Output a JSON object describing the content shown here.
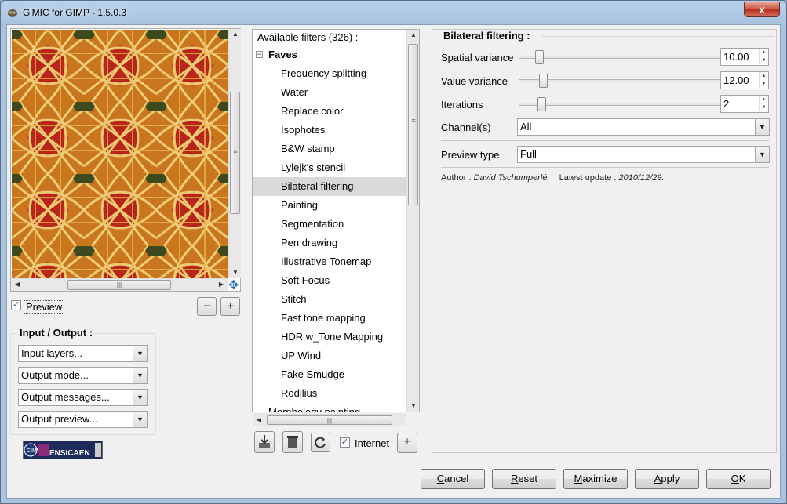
{
  "window": {
    "title": "G'MIC for GIMP - 1.5.0.3",
    "close_label": "x"
  },
  "preview": {
    "checkbox_checked": true,
    "label": "Preview",
    "zoom_out": "−",
    "zoom_in": "+"
  },
  "io": {
    "title": "Input / Output :",
    "combos": [
      "Input layers...",
      "Output mode...",
      "Output messages...",
      "Output preview..."
    ]
  },
  "logo": {
    "text": "ENSICAEN"
  },
  "filters": {
    "header": "Available filters (326) :",
    "category": "Faves",
    "items": [
      "Frequency splitting",
      "Water",
      "Replace color",
      "Isophotes",
      "B&W stamp",
      "Lylejk's stencil",
      "Bilateral filtering",
      "Painting",
      "Segmentation",
      "Pen drawing",
      "Illustrative Tonemap",
      "Soft Focus",
      "Stitch",
      "Fast tone mapping",
      "HDR w_Tone Mapping",
      "UP Wind",
      "Fake Smudge",
      "Rodilius"
    ],
    "partial_item": "Morphology painting",
    "selected": "Bilateral filtering",
    "internet_label": "Internet",
    "internet_checked": true,
    "add_label": "+"
  },
  "params": {
    "title": "Bilateral filtering :",
    "spatial": {
      "label": "Spatial variance",
      "value": "10.00"
    },
    "valuevar": {
      "label": "Value variance",
      "value": "12.00"
    },
    "iterations": {
      "label": "Iterations",
      "value": "2"
    },
    "channels": {
      "label": "Channel(s)",
      "value": "All"
    },
    "preview_type": {
      "label": "Preview type",
      "value": "Full"
    },
    "author_label": "Author :",
    "author_name": "David Tschumperlé.",
    "update_label": "Latest update :",
    "update_date": "2010/12/29."
  },
  "buttons": {
    "cancel_first": "C",
    "cancel_rest": "ancel",
    "reset_first": "R",
    "reset_rest": "eset",
    "maximize_first": "M",
    "maximize_rest": "aximize",
    "apply_first": "A",
    "apply_rest": "pply",
    "ok_first": "O",
    "ok_rest": "K"
  }
}
